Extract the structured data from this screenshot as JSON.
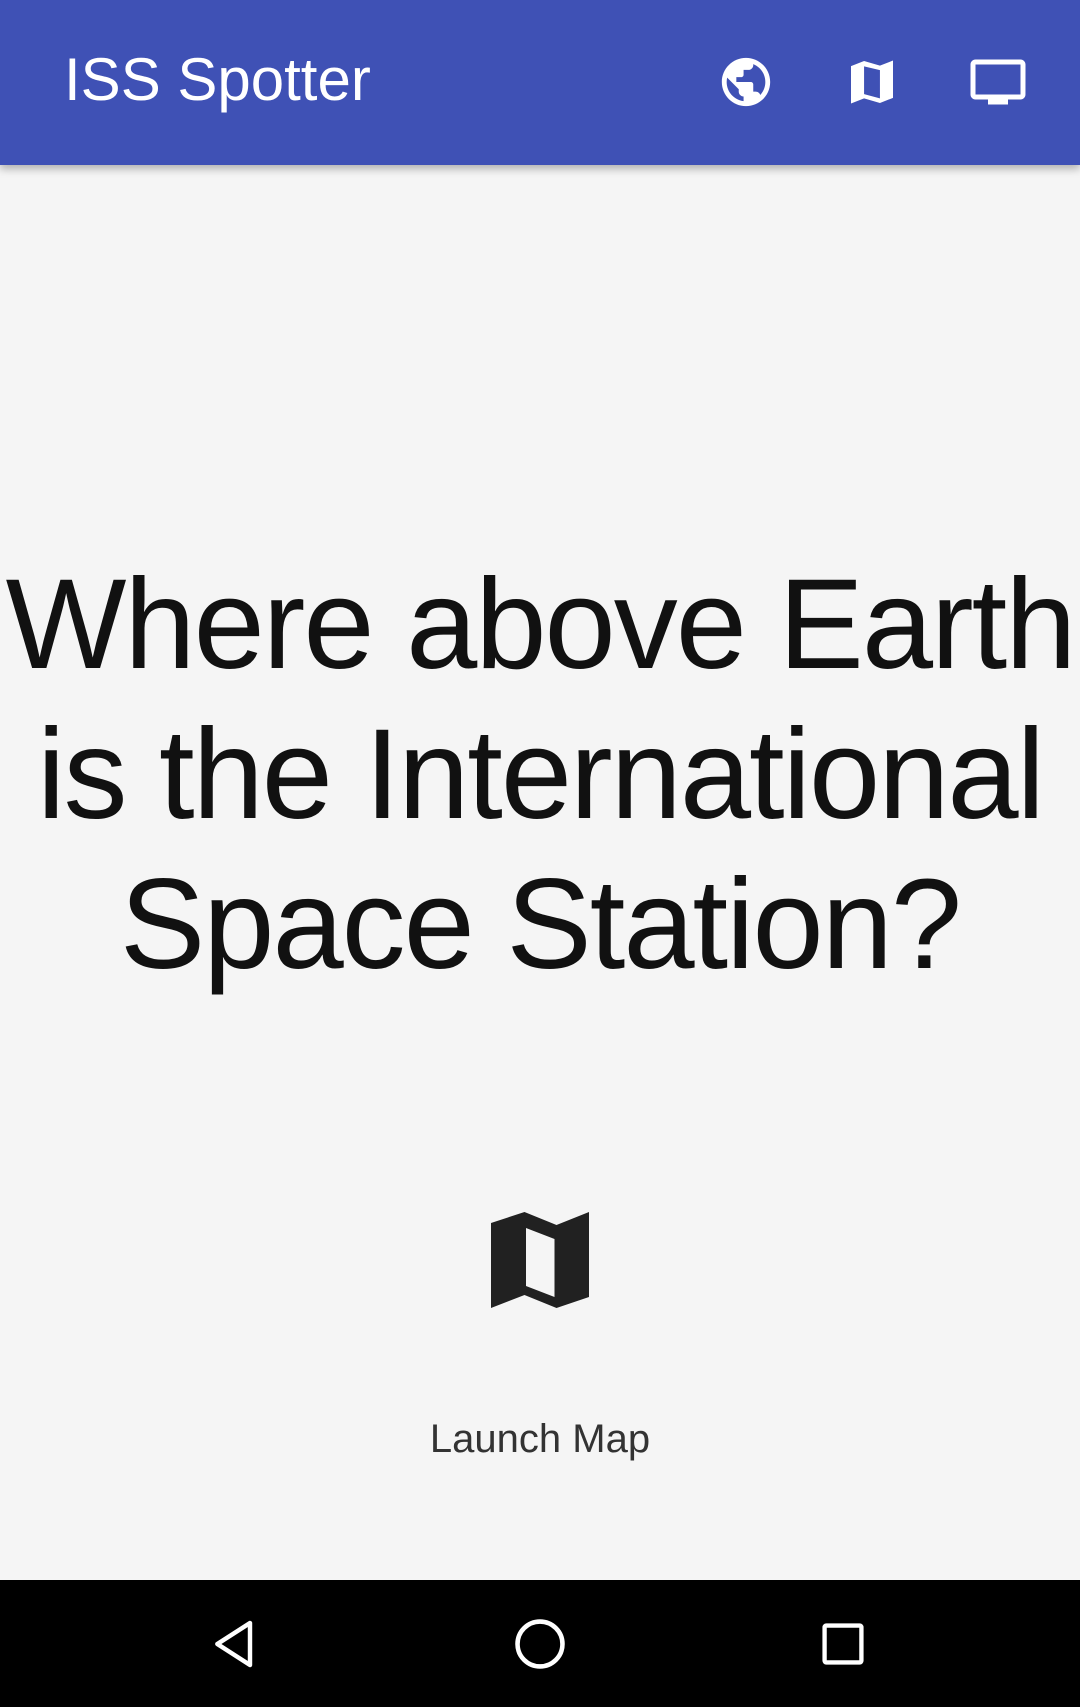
{
  "app_bar": {
    "title": "ISS Spotter",
    "background_color": "#3f51b5",
    "actions": [
      {
        "icon": "globe-icon"
      },
      {
        "icon": "map-icon"
      },
      {
        "icon": "tv-icon"
      }
    ]
  },
  "main": {
    "headline": "Where above Earth is the International Space Station?",
    "launch": {
      "icon": "map-icon",
      "label": "Launch Map"
    }
  },
  "nav_bar": {
    "buttons": [
      "back-icon",
      "home-icon",
      "recents-icon"
    ]
  }
}
